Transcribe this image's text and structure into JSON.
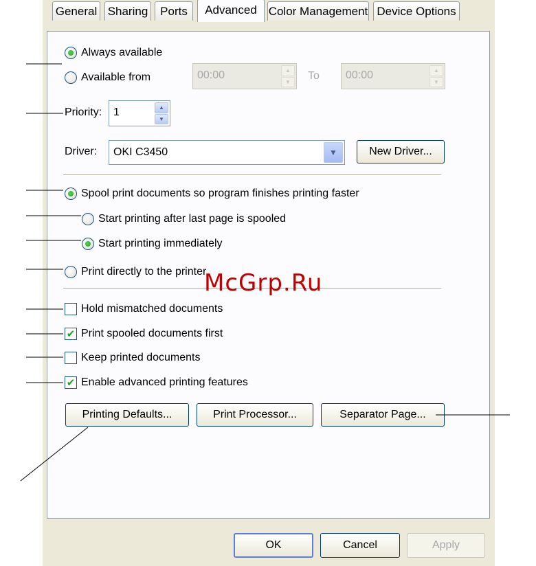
{
  "tabs": [
    "General",
    "Sharing",
    "Ports",
    "Advanced",
    "Color Management",
    "Device Options"
  ],
  "availability": {
    "always_label": "Always available",
    "from_label": "Available from",
    "from_time": "00:00",
    "to_label": "To",
    "to_time": "00:00",
    "selected": "always"
  },
  "priority": {
    "label": "Priority:",
    "value": "1"
  },
  "driver": {
    "label": "Driver:",
    "value": "OKI C3450",
    "new_driver_label": "New Driver..."
  },
  "spooling": {
    "spool_label": "Spool print documents so program finishes printing faster",
    "after_last_label": "Start printing after last page is spooled",
    "immediately_label": "Start printing immediately",
    "direct_label": "Print directly to the printer",
    "spool_selected": true,
    "start_mode": "immediately"
  },
  "options": {
    "hold_mismatched": {
      "label": "Hold mismatched documents",
      "checked": false
    },
    "spooled_first": {
      "label": "Print spooled documents first",
      "checked": true
    },
    "keep_printed": {
      "label": "Keep printed documents",
      "checked": false
    },
    "advanced_features": {
      "label": "Enable advanced printing features",
      "checked": true
    }
  },
  "buttons": {
    "printing_defaults": "Printing Defaults...",
    "print_processor": "Print Processor...",
    "separator_page": "Separator Page...",
    "ok": "OK",
    "cancel": "Cancel",
    "apply": "Apply"
  },
  "check_glyph": "✔",
  "watermark": "McGrp.Ru",
  "colors": {
    "accent_tab": "#e68b2c",
    "radio_dot": "#21a121",
    "watermark": "#c00000"
  }
}
